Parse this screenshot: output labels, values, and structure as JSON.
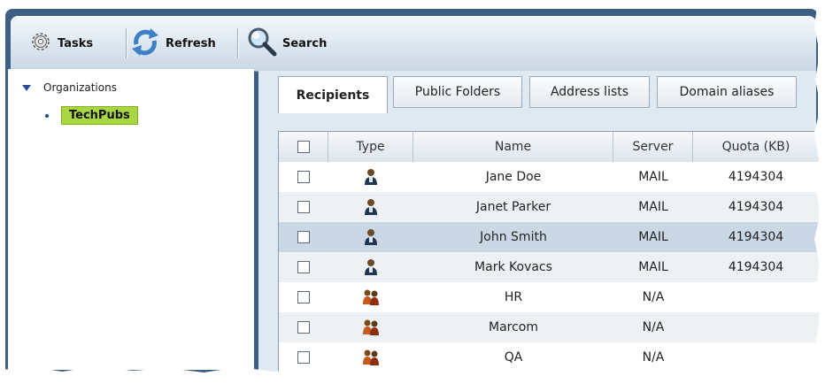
{
  "toolbar": {
    "tasks_label": "Tasks",
    "refresh_label": "Refresh",
    "search_label": "Search"
  },
  "tree": {
    "root_label": "Organizations",
    "selected_label": "TechPubs"
  },
  "tabs": [
    {
      "label": "Recipients",
      "active": true
    },
    {
      "label": "Public Folders",
      "active": false
    },
    {
      "label": "Address lists",
      "active": false
    },
    {
      "label": "Domain aliases",
      "active": false
    }
  ],
  "table": {
    "columns": [
      "Type",
      "Name",
      "Server",
      "Quota (KB)"
    ],
    "rows": [
      {
        "type_icon": "user-icon",
        "name": "Jane Doe",
        "server": "MAIL",
        "quota": "4194304",
        "selected": false
      },
      {
        "type_icon": "user-icon",
        "name": "Janet Parker",
        "server": "MAIL",
        "quota": "4194304",
        "selected": false
      },
      {
        "type_icon": "user-icon",
        "name": "John Smith",
        "server": "MAIL",
        "quota": "4194304",
        "selected": true
      },
      {
        "type_icon": "user-icon",
        "name": "Mark Kovacs",
        "server": "MAIL",
        "quota": "4194304",
        "selected": false
      },
      {
        "type_icon": "group-icon",
        "name": "HR",
        "server": "N/A",
        "quota": "",
        "selected": false
      },
      {
        "type_icon": "group-icon",
        "name": "Marcom",
        "server": "N/A",
        "quota": "",
        "selected": false
      },
      {
        "type_icon": "group-icon",
        "name": "QA",
        "server": "N/A",
        "quota": "",
        "selected": false
      }
    ]
  },
  "colors": {
    "frame": "#3d5f84",
    "selected_node": "#a9d744",
    "selected_row": "#c9d8e4",
    "alt_row": "#eef1f4"
  }
}
